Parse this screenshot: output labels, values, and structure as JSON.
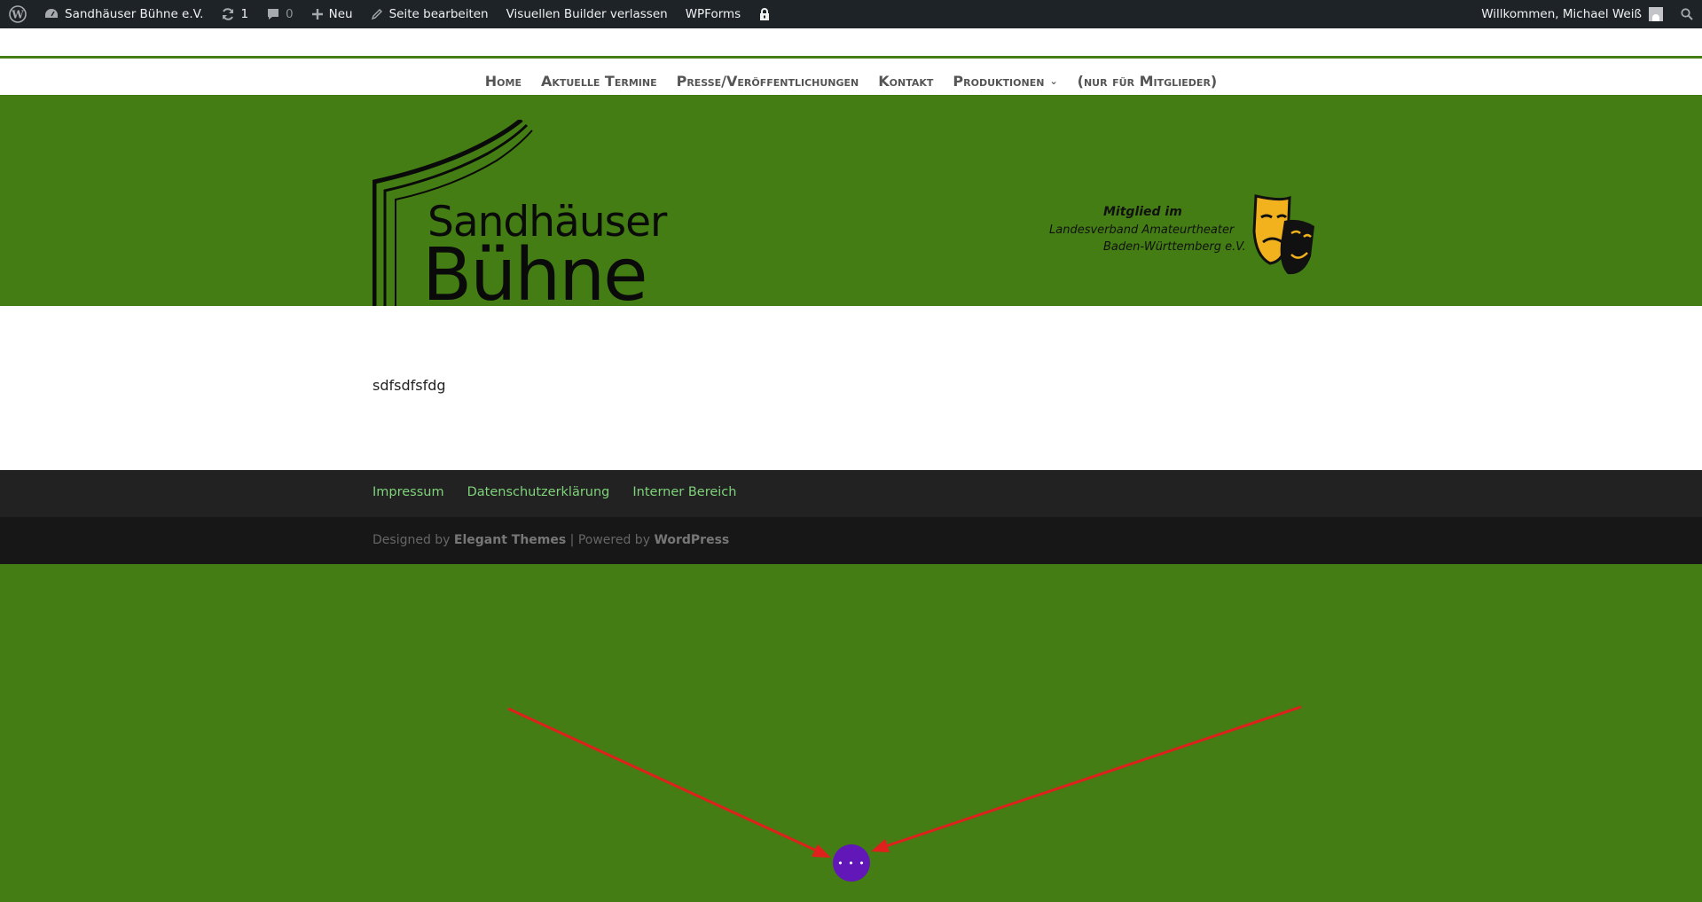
{
  "adminbar": {
    "site_name": "Sandhäuser Bühne e.V.",
    "updates_count": "1",
    "comments_count": "0",
    "new_label": "Neu",
    "edit_page_label": "Seite bearbeiten",
    "exit_builder_label": "Visuellen Builder verlassen",
    "wpforms_label": "WPForms",
    "greeting": "Willkommen, Michael Weiß"
  },
  "nav": {
    "items": [
      {
        "label": "Home"
      },
      {
        "label": "Aktuelle Termine"
      },
      {
        "label": "Presse/Veröffentlichungen"
      },
      {
        "label": "Kontakt"
      },
      {
        "label": "Produktionen"
      },
      {
        "label": "(nur für Mitglieder)"
      }
    ]
  },
  "banner": {
    "logo_line1": "Sandhäuser",
    "logo_line2": "Bühne",
    "member_line1": "Mitglied im",
    "member_line2": "Landesverband Amateurtheater",
    "member_line3": "Baden-Württemberg e.V."
  },
  "content": {
    "text": "sdfsdfsfdg"
  },
  "footer": {
    "links": [
      "Impressum",
      "Datenschutzerklärung",
      "Interner Bereich"
    ],
    "designed_by": "Designed by",
    "theme_name": "Elegant Themes",
    "separator": "| Powered by",
    "platform": "WordPress"
  },
  "builder": {
    "button_label": "• • •"
  },
  "colors": {
    "green": "#437d13",
    "adminbar": "#1d2327",
    "footer_link": "#7fd37a",
    "builder_button": "#6217b8",
    "arrow": "#e0201c"
  }
}
